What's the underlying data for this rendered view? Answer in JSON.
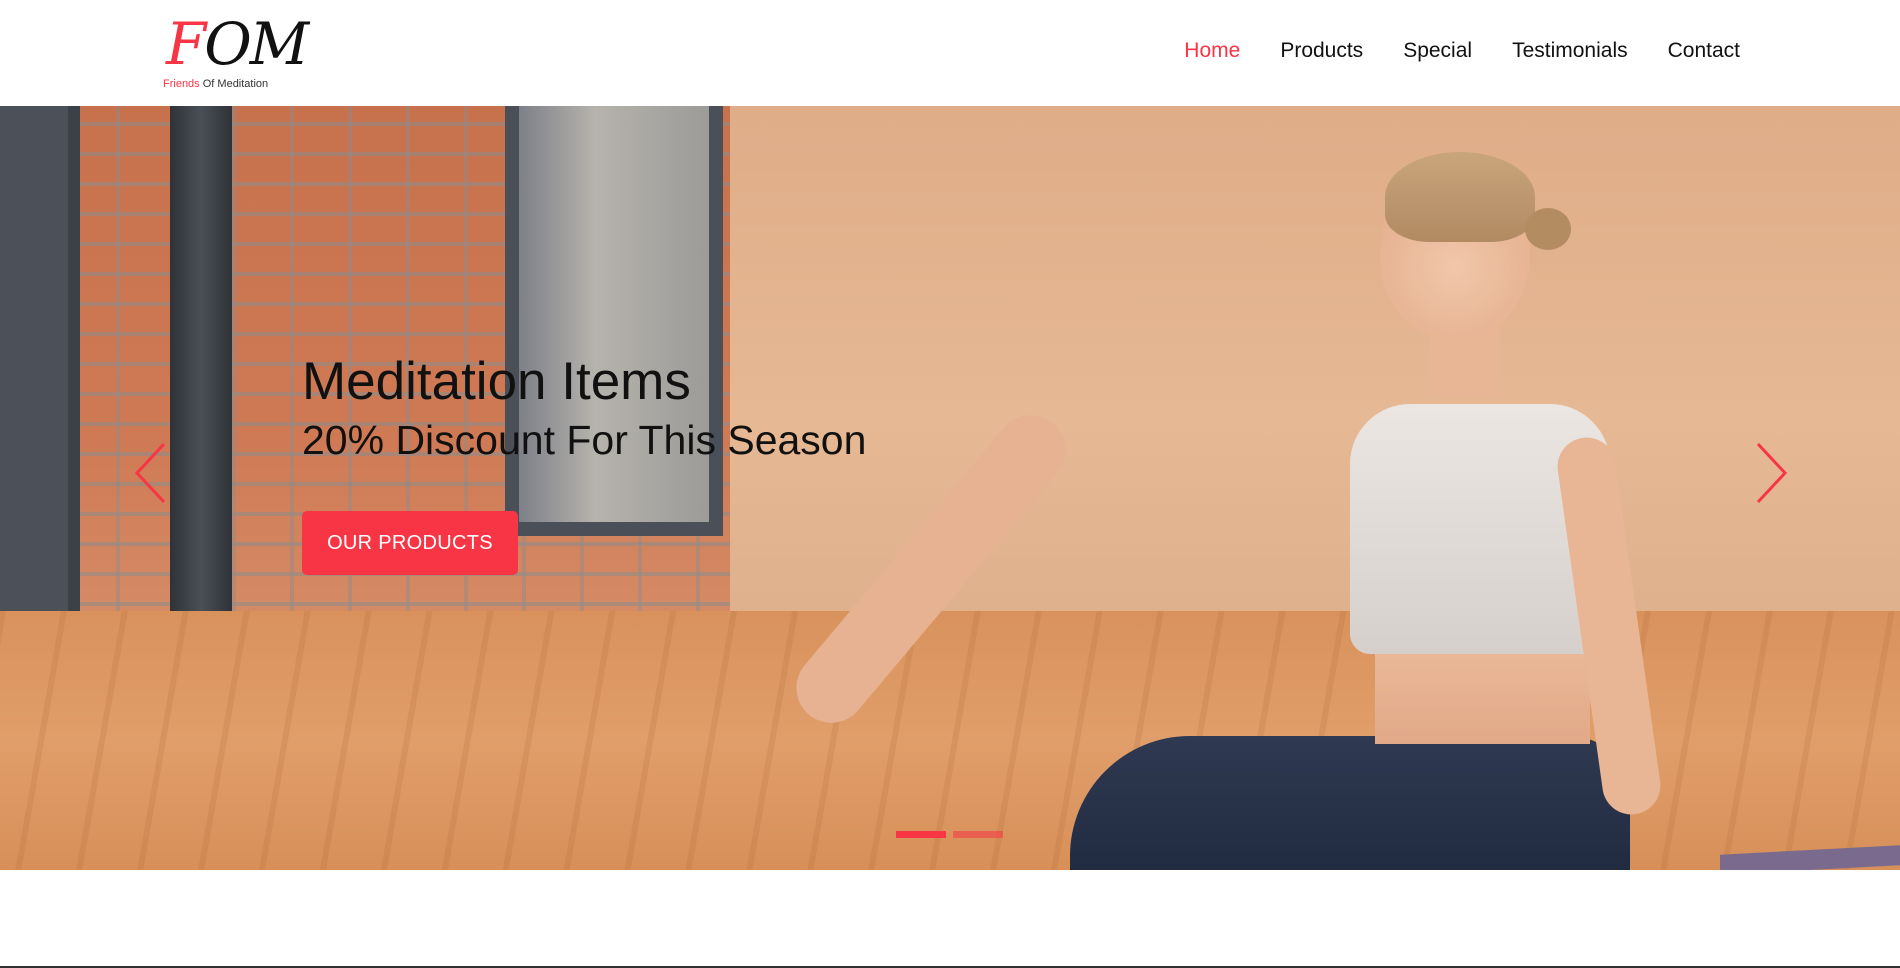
{
  "brand": {
    "logo_mark_first": "F",
    "logo_mark_rest": "OM",
    "tagline_accent": "Friends",
    "tagline_rest": " Of Meditation"
  },
  "nav": {
    "items": [
      {
        "label": "Home",
        "active": true
      },
      {
        "label": "Products",
        "active": false
      },
      {
        "label": "Special",
        "active": false
      },
      {
        "label": "Testimonials",
        "active": false
      },
      {
        "label": "Contact",
        "active": false
      }
    ]
  },
  "hero": {
    "title": "Meditation Items",
    "subtitle": "20% Discount For This Season",
    "cta_label": "OUR PRODUCTS",
    "slide_count": 2,
    "active_slide": 1
  },
  "icons": {
    "prev": "chevron-left-icon",
    "next": "chevron-right-icon"
  },
  "colors": {
    "accent": "#f73545",
    "text": "#111111",
    "background": "#ffffff"
  }
}
